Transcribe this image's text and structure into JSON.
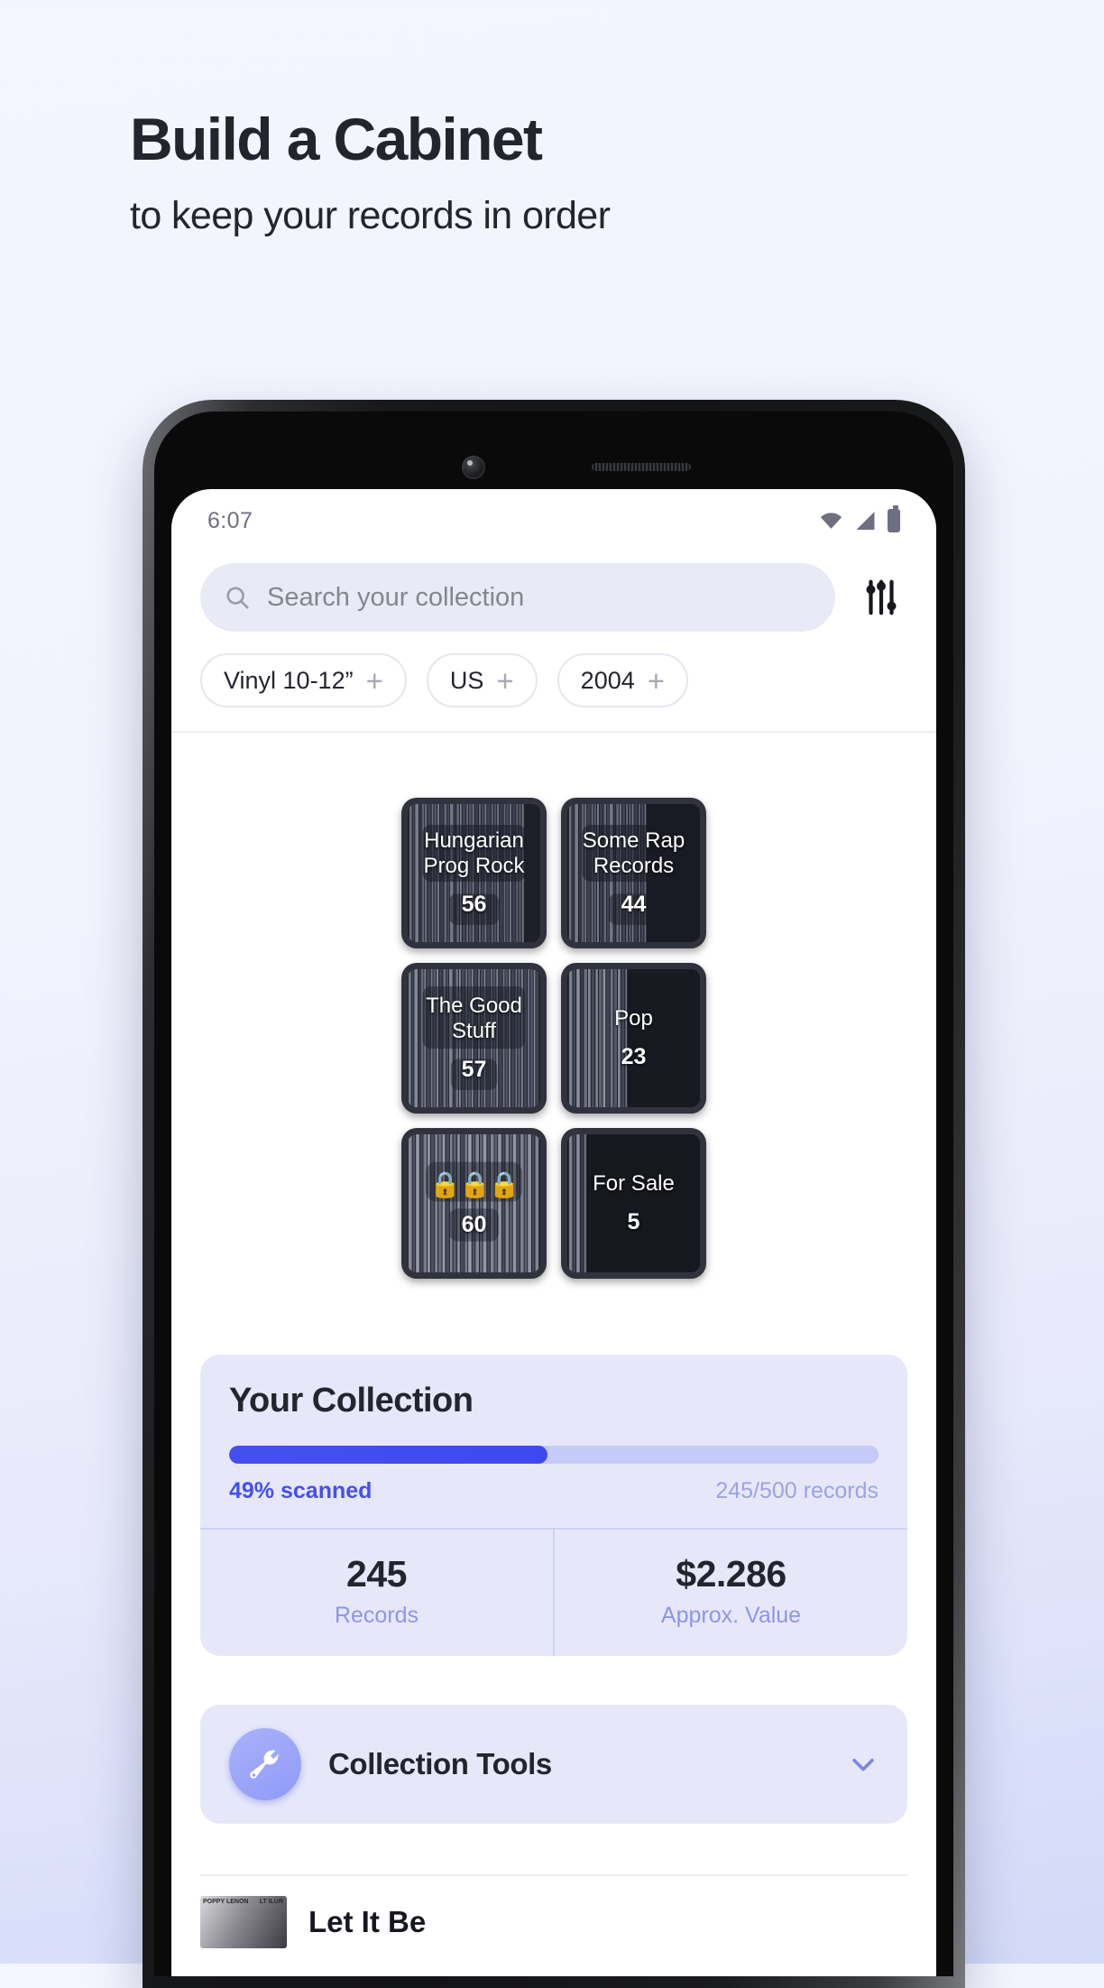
{
  "hero": {
    "title": "Build a Cabinet",
    "subtitle": "to keep your records in order"
  },
  "colors": {
    "accent": "#4450ee",
    "panel_bg": "#e6e8fa",
    "page_bg": "#f3f4fd",
    "card_bg": "#30323d",
    "muted_text": "#8d96e6"
  },
  "statusbar": {
    "time": "6:07",
    "icons": [
      "wifi-icon",
      "cellular-signal-icon",
      "battery-icon"
    ]
  },
  "search": {
    "placeholder": "Search your collection",
    "value": "",
    "icon": "search-icon",
    "filter_icon": "sliders-filter-icon"
  },
  "chips": [
    {
      "label": "Vinyl 10-12”",
      "add": "+"
    },
    {
      "label": "US",
      "add": "+"
    },
    {
      "label": "2004",
      "add": "+"
    }
  ],
  "cabinets": [
    {
      "title": "Hungarian Prog Rock",
      "count": "56",
      "emoji": ""
    },
    {
      "title": "Some Rap Records",
      "count": "44",
      "emoji": ""
    },
    {
      "title": "The Good Stuff",
      "count": "57",
      "emoji": ""
    },
    {
      "title": "Pop",
      "count": "23",
      "emoji": ""
    },
    {
      "title": "",
      "count": "60",
      "emoji": "🔒🔒🔒"
    },
    {
      "title": "For Sale",
      "count": "5",
      "emoji": ""
    }
  ],
  "collection": {
    "title": "Your Collection",
    "progress_percent": 49,
    "progress_label": "49% scanned",
    "records_label": "245/500 records",
    "stats": [
      {
        "value": "245",
        "label": "Records"
      },
      {
        "value": "$2.286",
        "label": "Approx. Value"
      }
    ]
  },
  "tools": {
    "label": "Collection Tools",
    "icon": "wrench-icon",
    "chevron": "chevron-down-icon"
  },
  "peek": {
    "title": "Let It Be",
    "thumb_left": "POPPY LENON",
    "thumb_right": "LT ILUR"
  }
}
